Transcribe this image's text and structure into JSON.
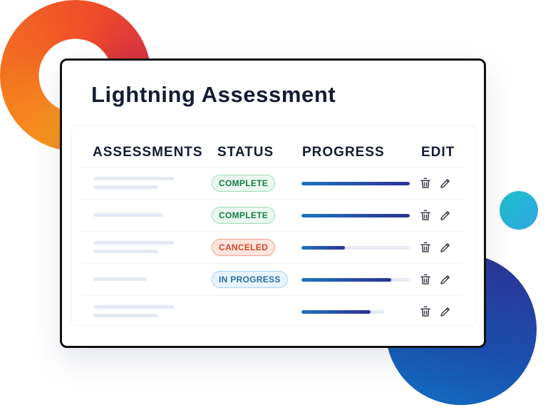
{
  "card": {
    "title": "Lightning Assessment"
  },
  "table": {
    "headers": {
      "assessments": "ASSESSMENTS",
      "status": "STATUS",
      "progress": "PROGRESS",
      "edit": "EDIT"
    },
    "rows": [
      {
        "status": "COMPLETE",
        "status_kind": "complete",
        "progress": 1.0,
        "track_length": "long"
      },
      {
        "status": "COMPLETE",
        "status_kind": "complete",
        "progress": 1.0,
        "track_length": "long"
      },
      {
        "status": "CANCELED",
        "status_kind": "canceled",
        "progress": 0.4,
        "track_length": "long"
      },
      {
        "status": "IN PROGRESS",
        "status_kind": "inprogress",
        "progress": 0.83,
        "track_length": "long"
      },
      {
        "status": "",
        "status_kind": "none",
        "progress": 0.84,
        "track_length": "short"
      }
    ],
    "row_actions": [
      "trash-icon",
      "pencil-icon"
    ]
  },
  "colors": {
    "title_text": "#141b33",
    "progress_start": "#1b75bc",
    "progress_end": "#2e3192",
    "complete": "#1a7a44",
    "canceled": "#cf4a2a",
    "in_progress": "#2a6e9e",
    "ring_orange": "#f26a21",
    "disc_blue": "#2e3192",
    "dot_teal": "#1ec0c9"
  }
}
